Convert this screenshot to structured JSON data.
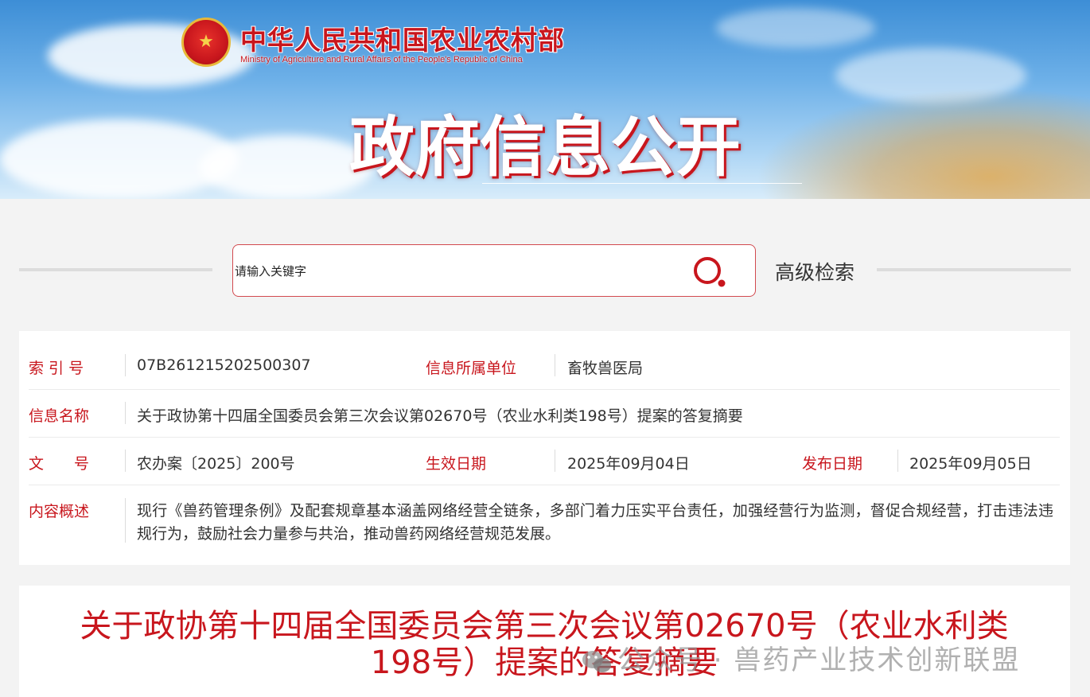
{
  "header": {
    "ministry_name_cn": "中华人民共和国农业农村部",
    "ministry_name_en": "Ministry of Agriculture and Rural Affairs of the People's Republic of China",
    "banner_title": "政府信息公开"
  },
  "search": {
    "placeholder": "请输入关键字",
    "advanced_label": "高级检索"
  },
  "info": {
    "index_label": "索 引 号",
    "index_value": "07B261215202500307",
    "unit_label": "信息所属单位",
    "unit_value": "畜牧兽医局",
    "name_label": "信息名称",
    "name_value": "关于政协第十四届全国委员会第三次会议第02670号（农业水利类198号）提案的答复摘要",
    "doc_label": "文　　号",
    "doc_value": "农办案〔2025〕200号",
    "effective_label": "生效日期",
    "effective_value": "2025年09月04日",
    "publish_label": "发布日期",
    "publish_value": "2025年09月05日",
    "summary_label": "内容概述",
    "summary_value": "现行《兽药管理条例》及配套规章基本涵盖网络经营全链条，多部门着力压实平台责任，加强经营行为监测，督促合规经营，打击违法违规行为，鼓励社会力量参与共治，推动兽药网络经营规范发展。"
  },
  "article": {
    "title_line1": "关于政协第十四届全国委员会第三次会议第02670号（农业水利类",
    "title_line2": "198号）提案的答复摘要"
  },
  "watermark": {
    "text": "公众号 · 兽药产业技术创新联盟"
  },
  "colors": {
    "accent": "#c8161d",
    "banner_sky": "#4a97dc"
  }
}
